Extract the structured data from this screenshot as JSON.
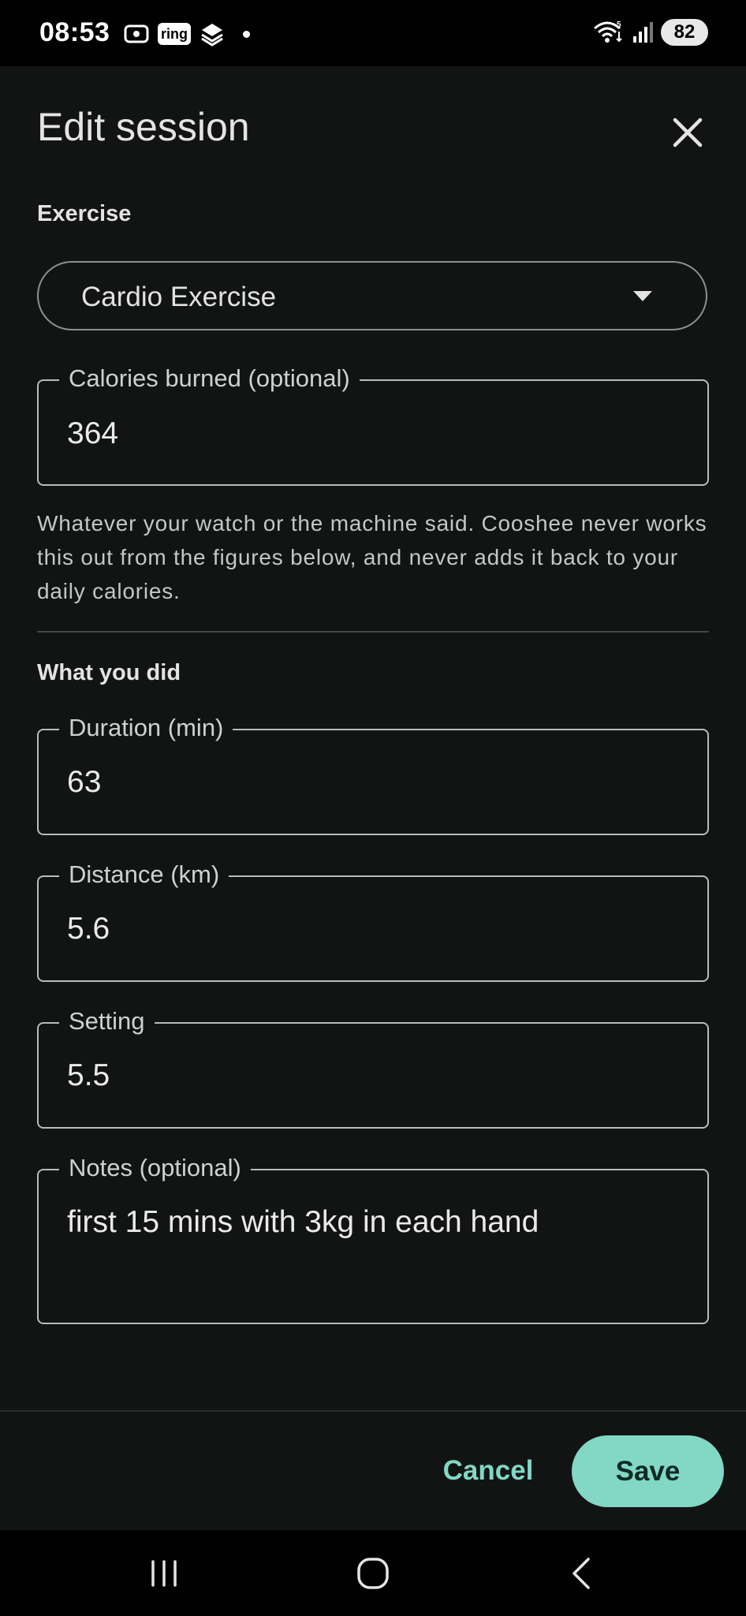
{
  "status_bar": {
    "time": "08:53",
    "ring_label": "ring",
    "battery": "82",
    "icons": [
      "screen-record-icon",
      "ring-app-icon",
      "stack-app-icon",
      "notification-dot",
      "wifi-icon",
      "cell-signal-icon",
      "battery-icon"
    ]
  },
  "dialog": {
    "title": "Edit session",
    "close_icon": "close-icon"
  },
  "exercise": {
    "section_label": "Exercise",
    "selected": "Cardio Exercise"
  },
  "calories": {
    "label": "Calories burned (optional)",
    "value": "364",
    "helper": "Whatever your watch or the machine said. Cooshee never works this out from the figures below, and never adds it back to your daily calories."
  },
  "what_you_did": {
    "section_label": "What you did",
    "duration": {
      "label": "Duration (min)",
      "value": "63"
    },
    "distance": {
      "label": "Distance (km)",
      "value": "5.6"
    },
    "setting": {
      "label": "Setting",
      "value": "5.5"
    },
    "notes": {
      "label": "Notes (optional)",
      "value": "first 15 mins with 3kg in each hand"
    }
  },
  "actions": {
    "cancel": "Cancel",
    "save": "Save"
  },
  "colors": {
    "background": "#121414",
    "accent": "#82d7c5",
    "outline": "#b9bcb9"
  }
}
